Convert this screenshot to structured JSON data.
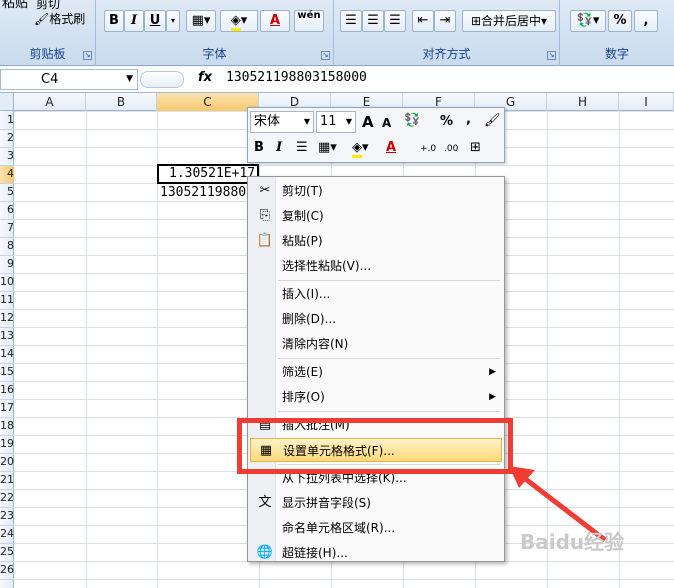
{
  "ribbon": {
    "clipboard": {
      "paste_label": "粘贴",
      "cut_label": "剪切",
      "format_painter_label": "格式刷",
      "group_label": "剪贴板"
    },
    "font": {
      "bold": "B",
      "italic": "I",
      "underline": "U",
      "font_color": "A",
      "phonetic": "wén",
      "group_label": "字体"
    },
    "alignment": {
      "merge_label": "合并后居中",
      "group_label": "对齐方式"
    },
    "number": {
      "percent": "%",
      "comma": ",",
      "group_label": "数字"
    }
  },
  "formula_bar": {
    "name_box": "C4",
    "fx": "fx",
    "value": "130521198803158000"
  },
  "columns": [
    "A",
    "B",
    "C",
    "D",
    "E",
    "F",
    "G",
    "H",
    "I"
  ],
  "rows": [
    "1",
    "2",
    "3",
    "4",
    "5",
    "6",
    "7",
    "8",
    "9",
    "10",
    "11",
    "12",
    "13",
    "14",
    "15",
    "16",
    "17",
    "18",
    "19",
    "20",
    "21",
    "22",
    "23",
    "24",
    "25",
    "26"
  ],
  "cells": {
    "c4": "1.30521E+17",
    "c5": "13052119880"
  },
  "mini_toolbar": {
    "font_name": "宋体",
    "font_size": "11",
    "grow": "A",
    "shrink": "A",
    "percent": "%",
    "comma": ",",
    "bold": "B",
    "italic": "I",
    "font_color": "A",
    "inc_decimal": "+.0",
    "dec_decimal": ".00"
  },
  "context_menu": [
    {
      "label": "剪切(T)",
      "icon": "scissors-icon",
      "glyph": "✂"
    },
    {
      "label": "复制(C)",
      "icon": "copy-icon",
      "glyph": "⎘"
    },
    {
      "label": "粘贴(P)",
      "icon": "paste-icon",
      "glyph": "📋"
    },
    {
      "label": "选择性粘贴(V)...",
      "icon": "",
      "glyph": ""
    },
    {
      "label": "插入(I)...",
      "icon": "",
      "glyph": ""
    },
    {
      "label": "删除(D)...",
      "icon": "",
      "glyph": ""
    },
    {
      "label": "清除内容(N)",
      "icon": "",
      "glyph": ""
    },
    {
      "label": "筛选(E)",
      "icon": "",
      "glyph": "",
      "submenu": true
    },
    {
      "label": "排序(O)",
      "icon": "",
      "glyph": "",
      "submenu": true
    },
    {
      "label": "插入批注(M)",
      "icon": "comment-icon",
      "glyph": "▤"
    },
    {
      "label": "设置单元格格式(F)...",
      "icon": "format-cells-icon",
      "glyph": "▦"
    },
    {
      "label": "从下拉列表中选择(K)...",
      "icon": "",
      "glyph": ""
    },
    {
      "label": "显示拼音字段(S)",
      "icon": "phonetic-icon",
      "glyph": "文"
    },
    {
      "label": "命名单元格区域(R)...",
      "icon": "",
      "glyph": ""
    },
    {
      "label": "超链接(H)...",
      "icon": "hyperlink-icon",
      "glyph": "🌐"
    }
  ],
  "watermark": "Baidu经验",
  "colors": {
    "highlight_border": "#f03c32",
    "selected_column": "#f9d99a"
  }
}
